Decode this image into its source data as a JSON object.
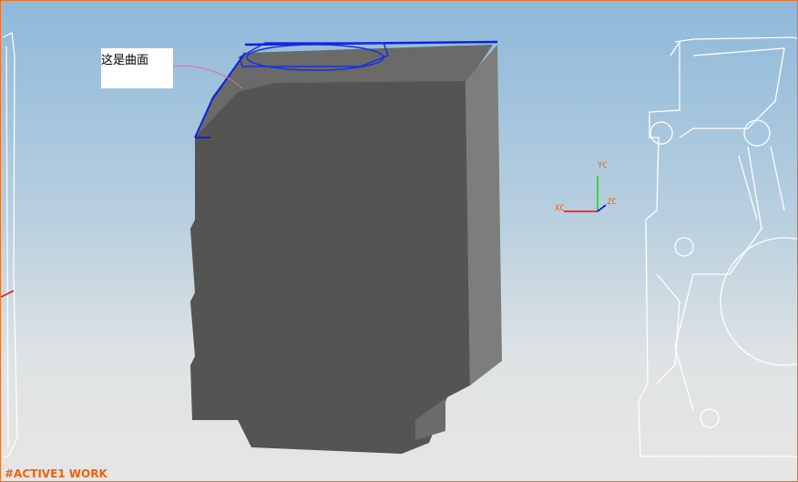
{
  "annotation": {
    "text": "这是曲面"
  },
  "wcs": {
    "x_label": "XC",
    "y_label": "YC",
    "z_label": "ZC"
  },
  "status": {
    "text": "#ACTIVE1 WORK"
  },
  "colors": {
    "border": "#f07020",
    "body": "#545553",
    "edge": "#1020e0"
  }
}
